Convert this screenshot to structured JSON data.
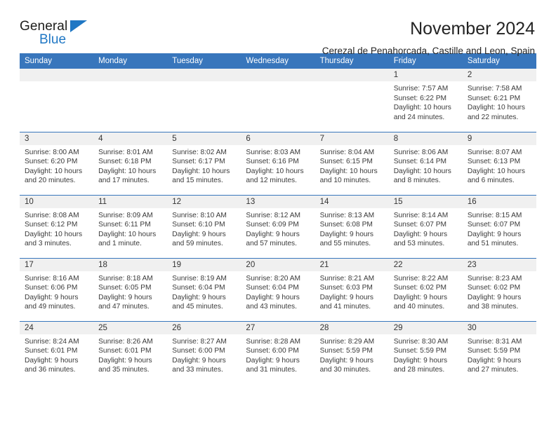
{
  "brand": {
    "line1": "General",
    "line2": "Blue",
    "triangle_color": "#1f77c4"
  },
  "header": {
    "title": "November 2024",
    "subtitle": "Cerezal de Penahorcada, Castille and Leon, Spain"
  },
  "theme": {
    "header_bg": "#3876bc",
    "date_strip_bg": "#f0f0f0",
    "grid_line": "#3876bc",
    "text": "#3a3a3a"
  },
  "calendar": {
    "weekday_headers": [
      "Sunday",
      "Monday",
      "Tuesday",
      "Wednesday",
      "Thursday",
      "Friday",
      "Saturday"
    ],
    "labels": {
      "sunrise": "Sunrise:",
      "sunset": "Sunset:",
      "daylight": "Daylight:"
    },
    "weeks": [
      [
        {
          "date": "",
          "empty": true
        },
        {
          "date": "",
          "empty": true
        },
        {
          "date": "",
          "empty": true
        },
        {
          "date": "",
          "empty": true
        },
        {
          "date": "",
          "empty": true
        },
        {
          "date": "1",
          "sunrise": "Sunrise: 7:57 AM",
          "sunset": "Sunset: 6:22 PM",
          "daylight": "Daylight: 10 hours and 24 minutes."
        },
        {
          "date": "2",
          "sunrise": "Sunrise: 7:58 AM",
          "sunset": "Sunset: 6:21 PM",
          "daylight": "Daylight: 10 hours and 22 minutes."
        }
      ],
      [
        {
          "date": "3",
          "sunrise": "Sunrise: 8:00 AM",
          "sunset": "Sunset: 6:20 PM",
          "daylight": "Daylight: 10 hours and 20 minutes."
        },
        {
          "date": "4",
          "sunrise": "Sunrise: 8:01 AM",
          "sunset": "Sunset: 6:18 PM",
          "daylight": "Daylight: 10 hours and 17 minutes."
        },
        {
          "date": "5",
          "sunrise": "Sunrise: 8:02 AM",
          "sunset": "Sunset: 6:17 PM",
          "daylight": "Daylight: 10 hours and 15 minutes."
        },
        {
          "date": "6",
          "sunrise": "Sunrise: 8:03 AM",
          "sunset": "Sunset: 6:16 PM",
          "daylight": "Daylight: 10 hours and 12 minutes."
        },
        {
          "date": "7",
          "sunrise": "Sunrise: 8:04 AM",
          "sunset": "Sunset: 6:15 PM",
          "daylight": "Daylight: 10 hours and 10 minutes."
        },
        {
          "date": "8",
          "sunrise": "Sunrise: 8:06 AM",
          "sunset": "Sunset: 6:14 PM",
          "daylight": "Daylight: 10 hours and 8 minutes."
        },
        {
          "date": "9",
          "sunrise": "Sunrise: 8:07 AM",
          "sunset": "Sunset: 6:13 PM",
          "daylight": "Daylight: 10 hours and 6 minutes."
        }
      ],
      [
        {
          "date": "10",
          "sunrise": "Sunrise: 8:08 AM",
          "sunset": "Sunset: 6:12 PM",
          "daylight": "Daylight: 10 hours and 3 minutes."
        },
        {
          "date": "11",
          "sunrise": "Sunrise: 8:09 AM",
          "sunset": "Sunset: 6:11 PM",
          "daylight": "Daylight: 10 hours and 1 minute."
        },
        {
          "date": "12",
          "sunrise": "Sunrise: 8:10 AM",
          "sunset": "Sunset: 6:10 PM",
          "daylight": "Daylight: 9 hours and 59 minutes."
        },
        {
          "date": "13",
          "sunrise": "Sunrise: 8:12 AM",
          "sunset": "Sunset: 6:09 PM",
          "daylight": "Daylight: 9 hours and 57 minutes."
        },
        {
          "date": "14",
          "sunrise": "Sunrise: 8:13 AM",
          "sunset": "Sunset: 6:08 PM",
          "daylight": "Daylight: 9 hours and 55 minutes."
        },
        {
          "date": "15",
          "sunrise": "Sunrise: 8:14 AM",
          "sunset": "Sunset: 6:07 PM",
          "daylight": "Daylight: 9 hours and 53 minutes."
        },
        {
          "date": "16",
          "sunrise": "Sunrise: 8:15 AM",
          "sunset": "Sunset: 6:07 PM",
          "daylight": "Daylight: 9 hours and 51 minutes."
        }
      ],
      [
        {
          "date": "17",
          "sunrise": "Sunrise: 8:16 AM",
          "sunset": "Sunset: 6:06 PM",
          "daylight": "Daylight: 9 hours and 49 minutes."
        },
        {
          "date": "18",
          "sunrise": "Sunrise: 8:18 AM",
          "sunset": "Sunset: 6:05 PM",
          "daylight": "Daylight: 9 hours and 47 minutes."
        },
        {
          "date": "19",
          "sunrise": "Sunrise: 8:19 AM",
          "sunset": "Sunset: 6:04 PM",
          "daylight": "Daylight: 9 hours and 45 minutes."
        },
        {
          "date": "20",
          "sunrise": "Sunrise: 8:20 AM",
          "sunset": "Sunset: 6:04 PM",
          "daylight": "Daylight: 9 hours and 43 minutes."
        },
        {
          "date": "21",
          "sunrise": "Sunrise: 8:21 AM",
          "sunset": "Sunset: 6:03 PM",
          "daylight": "Daylight: 9 hours and 41 minutes."
        },
        {
          "date": "22",
          "sunrise": "Sunrise: 8:22 AM",
          "sunset": "Sunset: 6:02 PM",
          "daylight": "Daylight: 9 hours and 40 minutes."
        },
        {
          "date": "23",
          "sunrise": "Sunrise: 8:23 AM",
          "sunset": "Sunset: 6:02 PM",
          "daylight": "Daylight: 9 hours and 38 minutes."
        }
      ],
      [
        {
          "date": "24",
          "sunrise": "Sunrise: 8:24 AM",
          "sunset": "Sunset: 6:01 PM",
          "daylight": "Daylight: 9 hours and 36 minutes."
        },
        {
          "date": "25",
          "sunrise": "Sunrise: 8:26 AM",
          "sunset": "Sunset: 6:01 PM",
          "daylight": "Daylight: 9 hours and 35 minutes."
        },
        {
          "date": "26",
          "sunrise": "Sunrise: 8:27 AM",
          "sunset": "Sunset: 6:00 PM",
          "daylight": "Daylight: 9 hours and 33 minutes."
        },
        {
          "date": "27",
          "sunrise": "Sunrise: 8:28 AM",
          "sunset": "Sunset: 6:00 PM",
          "daylight": "Daylight: 9 hours and 31 minutes."
        },
        {
          "date": "28",
          "sunrise": "Sunrise: 8:29 AM",
          "sunset": "Sunset: 5:59 PM",
          "daylight": "Daylight: 9 hours and 30 minutes."
        },
        {
          "date": "29",
          "sunrise": "Sunrise: 8:30 AM",
          "sunset": "Sunset: 5:59 PM",
          "daylight": "Daylight: 9 hours and 28 minutes."
        },
        {
          "date": "30",
          "sunrise": "Sunrise: 8:31 AM",
          "sunset": "Sunset: 5:59 PM",
          "daylight": "Daylight: 9 hours and 27 minutes."
        }
      ]
    ]
  }
}
